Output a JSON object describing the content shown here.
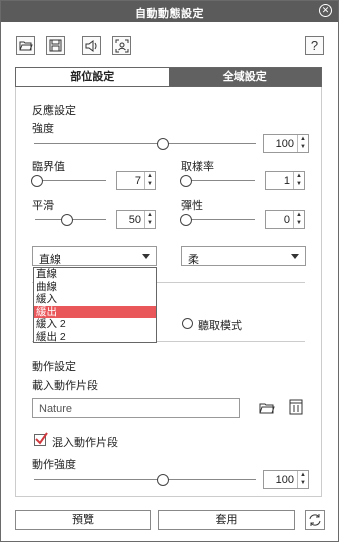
{
  "window": {
    "title": "自動動態設定"
  },
  "toolbar": {
    "help_label": "?",
    "icons": [
      "open-folder-icon",
      "save-icon",
      "speaker-icon",
      "face-capture-icon"
    ]
  },
  "tabs": [
    {
      "label": "部位設定",
      "active": false
    },
    {
      "label": "全域設定",
      "active": true
    }
  ],
  "response": {
    "section_label": "反應設定",
    "strength": {
      "label": "強度",
      "value": "100",
      "level": 0.58
    },
    "threshold": {
      "label": "臨界值",
      "value": "7",
      "level": 0.03
    },
    "sampling": {
      "label": "取樣率",
      "value": "1",
      "level": 0.03
    },
    "smooth": {
      "label": "平滑",
      "value": "50",
      "level": 0.45
    },
    "elastic": {
      "label": "彈性",
      "value": "0",
      "level": 0.03
    }
  },
  "curve_select": {
    "value": "直線",
    "options": [
      "直線",
      "曲線",
      "緩入",
      "緩出",
      "緩入 2",
      "緩出 2"
    ],
    "highlighted": "緩出"
  },
  "soft_select": {
    "value": "柔"
  },
  "mode": {
    "radio_label": "聽取模式"
  },
  "action": {
    "section_label": "動作設定",
    "load_label": "載入動作片段",
    "clip_value": "Nature",
    "mix_label": "混入動作片段",
    "mix_checked": true,
    "strength_label": "動作強度",
    "strength_value": "100",
    "strength_level": 0.58
  },
  "footer": {
    "preview_label": "預覽",
    "apply_label": "套用"
  },
  "colors": {
    "titlebar": "#5b5b5b",
    "active_tab": "#616161",
    "highlight": "#e9575b",
    "check": "#d03a3f"
  }
}
